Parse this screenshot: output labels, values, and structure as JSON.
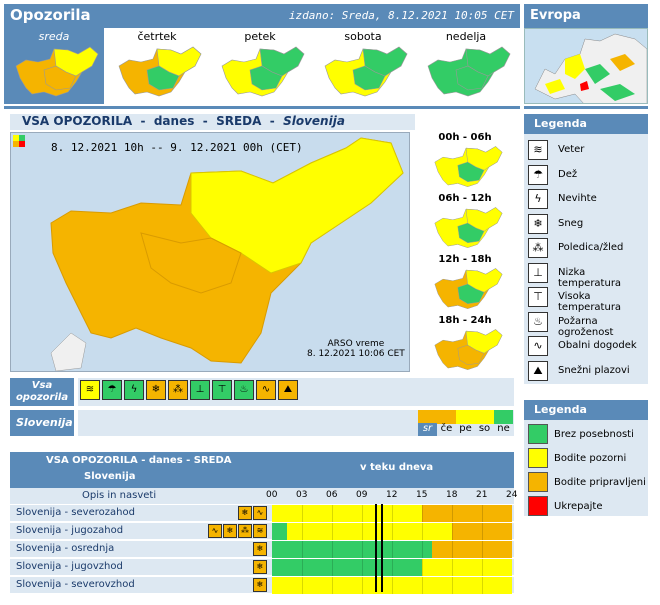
{
  "header": {
    "title": "Opozorila",
    "issued": "izdano: Sreda, 8.12.2021 10:05 CET",
    "europe_title": "Evropa"
  },
  "days": [
    {
      "label": "sreda",
      "active": true,
      "colors": [
        "#f5b400",
        "#f5b400",
        "#ffff00"
      ]
    },
    {
      "label": "četrtek",
      "colors": [
        "#f5b400",
        "#33cc66",
        "#ffff00"
      ]
    },
    {
      "label": "petek",
      "colors": [
        "#ffff00",
        "#33cc66",
        "#33cc66"
      ]
    },
    {
      "label": "sobota",
      "colors": [
        "#ffff00",
        "#33cc66",
        "#33cc66"
      ]
    },
    {
      "label": "nedelja",
      "colors": [
        "#33cc66",
        "#33cc66",
        "#33cc66"
      ]
    }
  ],
  "main": {
    "head_a": "VSA OPOZORILA",
    "head_sep": "-",
    "head_b": "danes",
    "head_c": "SREDA",
    "head_d": "Slovenija",
    "period": "8. 12.2021  10h  --  9. 12.2021  00h   (CET)",
    "arso_line1": "ARSO vreme",
    "arso_line2": "8. 12.2021  10:06 CET"
  },
  "quarters": [
    "00h - 06h",
    "06h - 12h",
    "12h - 18h",
    "18h - 24h"
  ],
  "legend1": {
    "title": "Legenda",
    "items": [
      {
        "label": "Veter",
        "icon": "wind-icon",
        "glyph": "≋"
      },
      {
        "label": "Dež",
        "icon": "rain-icon",
        "glyph": "☂"
      },
      {
        "label": "Nevihte",
        "icon": "lightning-icon",
        "glyph": "ϟ"
      },
      {
        "label": "Sneg",
        "icon": "snow-icon",
        "glyph": "❄"
      },
      {
        "label": "Poledica/žled",
        "icon": "ice-icon",
        "glyph": "⁂"
      },
      {
        "label": "Nizka temperatura",
        "icon": "low-temp-icon",
        "glyph": "⊥"
      },
      {
        "label": "Visoka temperatura",
        "icon": "high-temp-icon",
        "glyph": "⊤"
      },
      {
        "label": "Požarna ogroženost",
        "icon": "fire-icon",
        "glyph": "♨"
      },
      {
        "label": "Obalni dogodek",
        "icon": "coastal-icon",
        "glyph": "∿"
      },
      {
        "label": "Snežni plazovi",
        "icon": "avalanche-icon",
        "glyph": "⛰"
      }
    ]
  },
  "legend2": {
    "title": "Legenda",
    "items": [
      {
        "label": "Brez posebnosti",
        "color": "#33cc66"
      },
      {
        "label": "Bodite pozorni",
        "color": "#ffff00"
      },
      {
        "label": "Bodite pripravljeni",
        "color": "#f5b400"
      },
      {
        "label": "Ukrepajte",
        "color": "#ff0000"
      }
    ]
  },
  "strip": {
    "label": "Vsa opozorila",
    "icons": [
      {
        "name": "wind-icon",
        "glyph": "≋",
        "color": "#ffff00"
      },
      {
        "name": "rain-icon",
        "glyph": "☂",
        "color": "#33cc66"
      },
      {
        "name": "lightning-icon",
        "glyph": "ϟ",
        "color": "#33cc66"
      },
      {
        "name": "snow-icon",
        "glyph": "❄",
        "color": "#f5b400"
      },
      {
        "name": "ice-icon",
        "glyph": "⁂",
        "color": "#f5b400"
      },
      {
        "name": "low-temp-icon",
        "glyph": "⊥",
        "color": "#33cc66"
      },
      {
        "name": "high-temp-icon",
        "glyph": "⊤",
        "color": "#33cc66"
      },
      {
        "name": "fire-icon",
        "glyph": "♨",
        "color": "#33cc66"
      },
      {
        "name": "coastal-icon",
        "glyph": "∿",
        "color": "#f5b400"
      },
      {
        "name": "avalanche-icon",
        "glyph": "⛰",
        "color": "#f5b400"
      }
    ],
    "region": "Slovenija"
  },
  "scale": [
    {
      "label": "sr",
      "color": "#f5b400",
      "active": true
    },
    {
      "label": "če",
      "color": "#f5b400"
    },
    {
      "label": "pe",
      "color": "#ffff00"
    },
    {
      "label": "so",
      "color": "#ffff00"
    },
    {
      "label": "ne",
      "color": "#33cc66"
    }
  ],
  "table": {
    "title": "VSA OPOZORILA - danes - SREDA",
    "subtitle": "Slovenija",
    "period_label": "v teku dneva",
    "desc_label": "Opis in nasveti",
    "hours": [
      "00",
      "03",
      "06",
      "09",
      "12",
      "15",
      "18",
      "21",
      "24"
    ],
    "rows": [
      {
        "name": "Slovenija - severozahod",
        "icons": [
          "❄",
          "∿"
        ],
        "segments": [
          [
            0,
            15,
            "#ffff00"
          ],
          [
            15,
            18,
            "#f5b400"
          ],
          [
            18,
            21,
            "#f5b400"
          ],
          [
            21,
            24,
            "#f5b400"
          ]
        ],
        "fill_from_hour": 0
      },
      {
        "name": "Slovenija - jugozahod",
        "icons": [
          "∿",
          "❄",
          "⁂",
          "≋"
        ],
        "segments": [
          [
            0,
            1.5,
            "#33cc66"
          ],
          [
            1.5,
            18,
            "#ffff00"
          ],
          [
            18,
            24,
            "#f5b400"
          ]
        ]
      },
      {
        "name": "Slovenija - osrednja",
        "icons": [
          "❄"
        ],
        "segments": [
          [
            0,
            16,
            "#33cc66"
          ],
          [
            16,
            24,
            "#f5b400"
          ]
        ]
      },
      {
        "name": "Slovenija - jugovzhod",
        "icons": [
          "❄"
        ],
        "segments": [
          [
            0,
            15,
            "#33cc66"
          ],
          [
            15,
            24,
            "#ffff00"
          ]
        ]
      },
      {
        "name": "Slovenija - severovzhod",
        "icons": [
          "❄"
        ],
        "segments": [
          [
            0,
            9,
            "#ffff00"
          ],
          [
            9,
            24,
            "#ffff00"
          ]
        ]
      }
    ]
  }
}
